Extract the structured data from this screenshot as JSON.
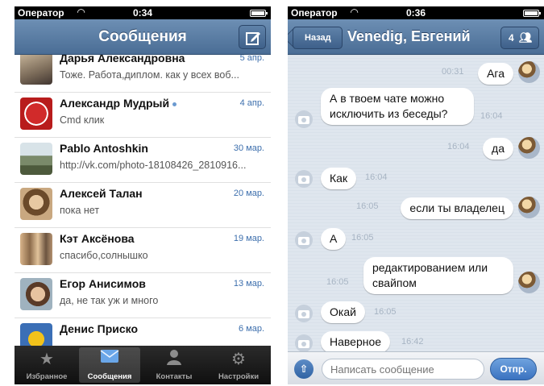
{
  "left_screen": {
    "status": {
      "carrier": "Оператор",
      "time": "0:34"
    },
    "title": "Сообщения",
    "conversations": [
      {
        "name": "Дарья Александровна",
        "date": "5 апр.",
        "preview": "Тоже. Работа,диплом. как у всех воб..."
      },
      {
        "name": "Александр Мудрый",
        "date": "4 апр.",
        "preview": "Cmd клик",
        "online": true
      },
      {
        "name": "Pablo Antoshkin",
        "date": "30 мар.",
        "preview": "http://vk.com/photo-18108426_2810916..."
      },
      {
        "name": "Алексей Талан",
        "date": "20 мар.",
        "preview": "пока нет"
      },
      {
        "name": "Кэт Аксёнова",
        "date": "19 мар.",
        "preview": "спасибо,солнышко"
      },
      {
        "name": "Егор Анисимов",
        "date": "13 мар.",
        "preview": "да, не так уж и много"
      },
      {
        "name": "Денис Приско",
        "date": "6 мар.",
        "preview": ""
      }
    ],
    "tabs": [
      {
        "label": "Избранное",
        "icon": "star-icon"
      },
      {
        "label": "Сообщения",
        "icon": "envelope-icon",
        "active": true
      },
      {
        "label": "Контакты",
        "icon": "person-icon"
      },
      {
        "label": "Настройки",
        "icon": "gear-icon"
      }
    ]
  },
  "right_screen": {
    "status": {
      "carrier": "Оператор",
      "time": "0:36"
    },
    "back_label": "Назад",
    "title": "Venedig, Евгений",
    "members_count": "4",
    "messages": [
      {
        "text": "Ага",
        "time": "00:31",
        "mine": true
      },
      {
        "text": "А в твоем чате можно исключить из беседы?",
        "time": "16:04",
        "mine": false
      },
      {
        "text": "да",
        "time": "16:04",
        "mine": true
      },
      {
        "text": "Как",
        "time": "16:04",
        "mine": false
      },
      {
        "text": "если ты владелец",
        "time": "16:05",
        "mine": true
      },
      {
        "text": "А",
        "time": "16:05",
        "mine": false
      },
      {
        "text": "редактированием или свайпом",
        "time": "16:05",
        "mine": true
      },
      {
        "text": "Окай",
        "time": "16:05",
        "mine": false
      },
      {
        "text": "Наверное",
        "time": "16:42",
        "mine": false
      }
    ],
    "input_placeholder": "Написать сообщение",
    "send_label": "Отпр."
  },
  "colors": {
    "navbar": "#5579a2",
    "accent": "#3d6fad",
    "tabbar": "#1a1a1a",
    "chat_bg": "#dfe6ee"
  }
}
